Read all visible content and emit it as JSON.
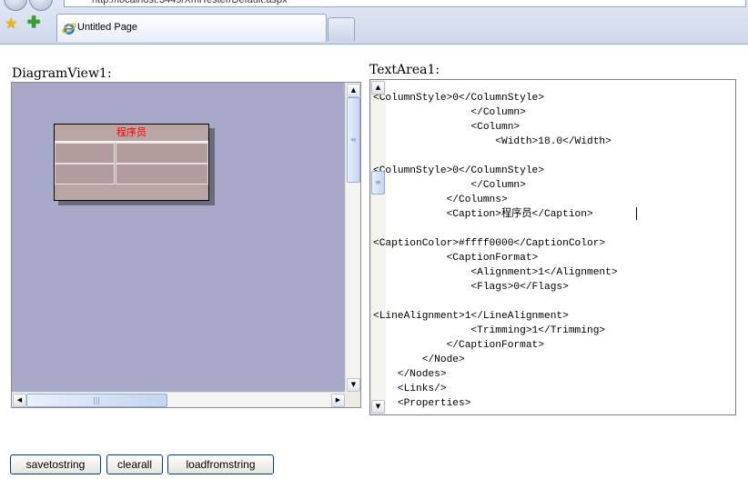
{
  "browser": {
    "address": "http://localhost:3449/XmlTester/Default.aspx",
    "tab_title": "Untitled Page",
    "icons": [
      "back-icon",
      "forward-icon",
      "favorites-star-icon",
      "add-favorites-icon",
      "ie-icon"
    ]
  },
  "diagram": {
    "label": "DiagramView1:",
    "background_color": "#a8a8c8",
    "node": {
      "caption": "程序员",
      "caption_color": "#ff0000",
      "fill_color": "#bba4a4",
      "rows": 2,
      "columns": 2
    }
  },
  "textarea": {
    "label": "TextArea1:",
    "lines": [
      "<ColumnStyle>0</ColumnStyle>",
      "                </Column>",
      "                <Column>",
      "                    <Width>18.0</Width>",
      "",
      "<ColumnStyle>0</ColumnStyle>",
      "                </Column>",
      "            </Columns>",
      "            <Caption>程序员</Caption>",
      "",
      "<CaptionColor>#ffff0000</CaptionColor>",
      "            <CaptionFormat>",
      "                <Alignment>1</Alignment>",
      "                <Flags>0</Flags>",
      "",
      "<LineAlignment>1</LineAlignment>",
      "                <Trimming>1</Trimming>",
      "            </CaptionFormat>",
      "        </Node>",
      "    </Nodes>",
      "    <Links/>",
      "    <Properties>"
    ]
  },
  "buttons": {
    "save": "savetostring",
    "clear": "clearall",
    "load": "loadfromstring"
  },
  "scrollbars": {
    "textarea_vertical_fraction": 0.27,
    "diagram_vertical_fraction": 0.0,
    "diagram_horizontal_fraction": 0.0
  }
}
